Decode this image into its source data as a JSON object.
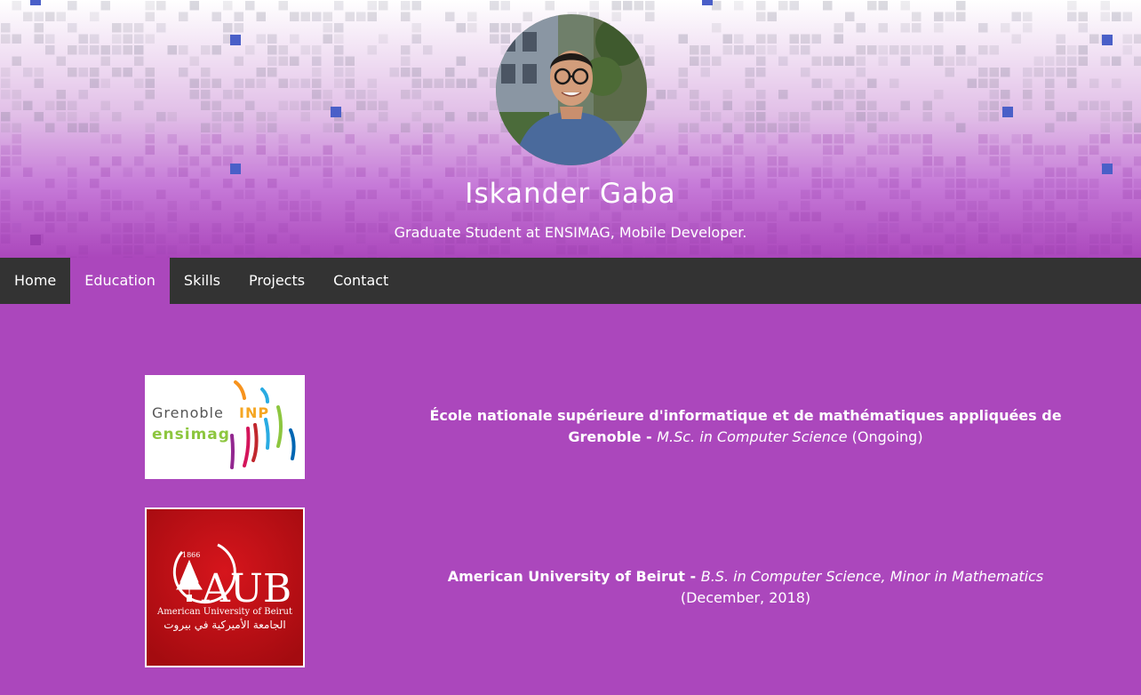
{
  "header": {
    "name": "Iskander Gaba",
    "tagline": "Graduate Student at ENSIMAG, Mobile Developer."
  },
  "nav": {
    "items": [
      {
        "label": "Home",
        "active": false
      },
      {
        "label": "Education",
        "active": true
      },
      {
        "label": "Skills",
        "active": false
      },
      {
        "label": "Projects",
        "active": false
      },
      {
        "label": "Contact",
        "active": false
      }
    ]
  },
  "education": [
    {
      "institution": "École nationale supérieure d'informatique et de mathématiques appliquées de Grenoble",
      "separator": " - ",
      "degree": "M.Sc. in Computer Science",
      "period": " (Ongoing)",
      "logo": {
        "line1": "Grenoble",
        "line1_accent": "INP",
        "line2": "ensimag"
      }
    },
    {
      "institution": "American University of Beirut",
      "separator": " - ",
      "degree": "B.S. in Computer Science, Minor in Mathematics",
      "period": "(December, 2018)",
      "logo": {
        "year": "1866",
        "letters": "AUB",
        "subtitle": "American University of Beirut",
        "arabic": "الجامعة الأميركية في بيروت"
      }
    }
  ],
  "colors": {
    "accent": "#ab47bc",
    "navbar": "#333333",
    "aub_red": "#c8102e",
    "ensimag_green": "#8dc63f"
  }
}
